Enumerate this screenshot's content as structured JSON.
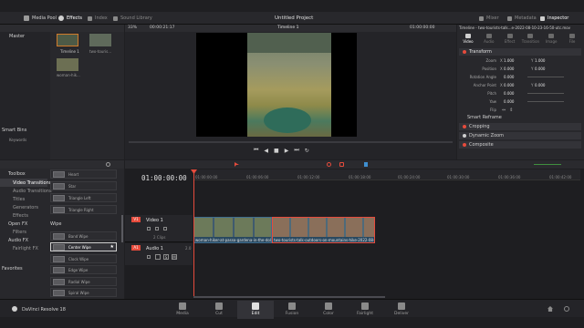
{
  "topbar": {
    "tabs": [
      {
        "label": "Media Pool",
        "icon": "media-pool-icon"
      },
      {
        "label": "Effects",
        "icon": "effects-icon"
      },
      {
        "label": "Index",
        "icon": "index-icon"
      },
      {
        "label": "Sound Library",
        "icon": "sound-library-icon"
      }
    ],
    "project_title": "Untitled Project",
    "right_tabs": [
      {
        "label": "Mixer",
        "icon": "mixer-icon"
      },
      {
        "label": "Metadata",
        "icon": "metadata-icon"
      },
      {
        "label": "Inspector",
        "icon": "inspector-icon"
      }
    ]
  },
  "viewer_bar": {
    "zoom": "33%",
    "timecode_left": "00:00:21:17",
    "timeline_name": "Timeline 1",
    "timecode_right": "01:00:00:00",
    "clip_title": "Timeline - two-tourists-talk...e-2022-08-10-23-16-50-utc.mov"
  },
  "media_pool": {
    "bins_header": "Master",
    "clips": [
      {
        "label": "Timeline 1"
      },
      {
        "label": "two-touris..."
      },
      {
        "label": "woman-hik..."
      }
    ],
    "smart_bins": "Smart Bins",
    "keywords": "Keywords"
  },
  "effects": {
    "toolbox": "Toolbox",
    "tree": [
      "Video Transitions",
      "Audio Transitions",
      "Titles",
      "Generators",
      "Effects"
    ],
    "open_fx": "Open FX",
    "filters": "Filters",
    "audio_fx": "Audio FX",
    "fairlight_fx": "Fairlight FX",
    "favorites": "Favorites",
    "shapes": [
      "Heart",
      "Star",
      "Triangle Left",
      "Triangle Right"
    ],
    "wipe_header": "Wipe",
    "wipes": [
      "Band Wipe",
      "Center Wipe",
      "Clock Wipe",
      "Edge Wipe",
      "Radial Wipe",
      "Spiral Wipe"
    ]
  },
  "inspector": {
    "tabs": [
      "Video",
      "Audio",
      "Effect",
      "Transition",
      "Image",
      "File"
    ],
    "transform": "Transform",
    "rows": [
      {
        "label": "Zoom",
        "x": "1.000",
        "y": "1.000"
      },
      {
        "label": "Position",
        "x": "0.000",
        "y": "0.000"
      },
      {
        "label": "Rotation Angle",
        "x": "0.000",
        "y": ""
      },
      {
        "label": "Anchor Point",
        "x": "0.000",
        "y": "0.000"
      },
      {
        "label": "Pitch",
        "x": "0.000",
        "y": ""
      },
      {
        "label": "Yaw",
        "x": "0.000",
        "y": ""
      },
      {
        "label": "Flip",
        "x": "",
        "y": ""
      }
    ],
    "sections": [
      "Smart Reframe",
      "Cropping",
      "Dynamic Zoom",
      "Composite"
    ]
  },
  "timeline": {
    "timecode": "01:00:00:00",
    "ruler": [
      "01:00:00:00",
      "01:00:06:00",
      "01:00:12:00",
      "01:00:18:00",
      "01:00:24:00",
      "01:00:30:00",
      "01:00:36:00",
      "01:00:42:00"
    ],
    "video_track": {
      "id": "V1",
      "name": "Video 1",
      "clip_count": "2 Clips"
    },
    "audio_track": {
      "id": "A1",
      "name": "Audio 1",
      "channels": "2.0"
    },
    "clips": [
      {
        "label": "woman-hiker-at-passo-gardena-in-the-dolo..."
      },
      {
        "label": "two-tourists-talk-outdoors-on-mountains-hike-2022-08-10-23..."
      }
    ]
  },
  "pages": [
    "Media",
    "Cut",
    "Edit",
    "Fusion",
    "Color",
    "Fairlight",
    "Deliver"
  ],
  "brand": "DaVinci Resolve 18",
  "colors": {
    "accent": "#e64b3c",
    "active_blue": "#3f8fd0",
    "clip_blue": "#2a4960"
  }
}
